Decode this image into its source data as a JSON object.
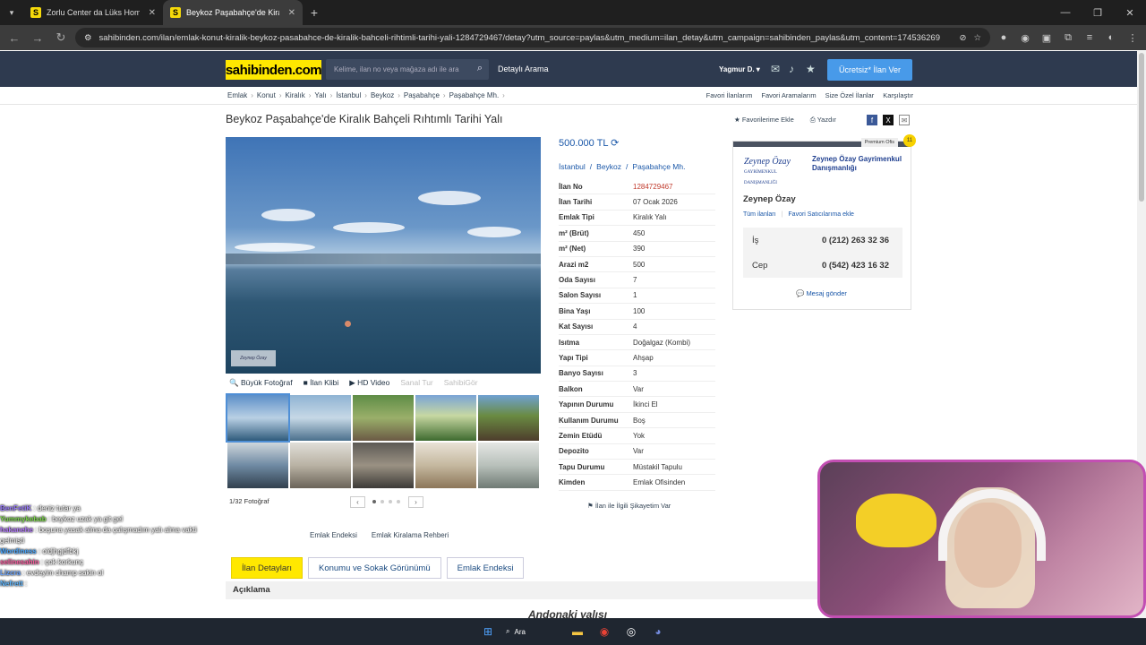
{
  "browser": {
    "tabs": [
      {
        "title": "Zorlu Center da Lüks Home Ofis",
        "active": false
      },
      {
        "title": "Beykoz Paşabahçe'de Kiralık Bahçeli",
        "active": true
      }
    ],
    "url": "sahibinden.com/ilan/emlak-konut-kiralik-beykoz-pasabahce-de-kiralik-bahceli-rihtimli-tarihi-yali-1284729467/detay?utm_source=paylas&utm_medium=ilan_detay&utm_campaign=sahibinden_paylas&utm_content=174536269"
  },
  "header": {
    "logo": "sahibinden.com",
    "search_placeholder": "Kelime, ilan no veya mağaza adı ile ara",
    "advanced_search": "Detaylı Arama",
    "user": "Yagmur D.",
    "post_button": "Ücretsiz* İlan Ver"
  },
  "breadcrumb": [
    "Emlak",
    "Konut",
    "Kiralık",
    "Yalı",
    "İstanbul",
    "Beykoz",
    "Paşabahçe",
    "Paşabahçe Mh."
  ],
  "quick_links": [
    "Favori İlanlarım",
    "Favori Aramalarım",
    "Size Özel İlanlar",
    "Karşılaştır"
  ],
  "listing": {
    "title": "Beykoz Paşabahçe'de Kiralık Bahçeli Rıhtımlı Tarihi Yalı",
    "add_favorite": "Favorilerime Ekle",
    "print": "Yazdır",
    "price": "500.000 TL",
    "location": [
      "İstanbul",
      "Beykoz",
      "Paşabahçe Mh."
    ],
    "attributes": [
      {
        "k": "İlan No",
        "v": "1284729467"
      },
      {
        "k": "İlan Tarihi",
        "v": "07 Ocak 2026"
      },
      {
        "k": "Emlak Tipi",
        "v": "Kiralık Yalı"
      },
      {
        "k": "m² (Brüt)",
        "v": "450"
      },
      {
        "k": "m² (Net)",
        "v": "390"
      },
      {
        "k": "Arazi m2",
        "v": "500"
      },
      {
        "k": "Oda Sayısı",
        "v": "7"
      },
      {
        "k": "Salon Sayısı",
        "v": "1"
      },
      {
        "k": "Bina Yaşı",
        "v": "100"
      },
      {
        "k": "Kat Sayısı",
        "v": "4"
      },
      {
        "k": "Isıtma",
        "v": "Doğalgaz (Kombi)"
      },
      {
        "k": "Yapı Tipi",
        "v": "Ahşap"
      },
      {
        "k": "Banyo Sayısı",
        "v": "3"
      },
      {
        "k": "Balkon",
        "v": "Var"
      },
      {
        "k": "Yapının Durumu",
        "v": "İkinci El"
      },
      {
        "k": "Kullanım Durumu",
        "v": "Boş"
      },
      {
        "k": "Zemin Etüdü",
        "v": "Yok"
      },
      {
        "k": "Depozito",
        "v": "Var"
      },
      {
        "k": "Tapu Durumu",
        "v": "Müstakil Tapulu"
      },
      {
        "k": "Kimden",
        "v": "Emlak Ofisinden"
      }
    ],
    "complaint": "İlan ile İlgili Şikayetim Var"
  },
  "gallery": {
    "tools": [
      "Büyük Fotoğraf",
      "İlan Klibi",
      "HD Video",
      "Sanal Tur",
      "SahibiGör"
    ],
    "counter": "1/32 Fotoğraf",
    "watermark": "Zeynep Özay"
  },
  "seller": {
    "premium": "Premium Ofis",
    "logo_text": "Zeynep Özay",
    "logo_sub": "GAYRİMENKUL DANIŞMANLIĞI",
    "company": "Zeynep Özay Gayrimenkul Danışmanlığı",
    "person": "Zeynep Özay",
    "links": [
      "Tüm ilanları",
      "Favori Satıcılarıma ekle"
    ],
    "phones": [
      {
        "label": "İş",
        "number": "0 (212) 263 32 36"
      },
      {
        "label": "Cep",
        "number": "0 (542) 423 16 32"
      }
    ],
    "message": "Mesaj gönder"
  },
  "bottom": {
    "links": [
      "Emlak Endeksi",
      "Emlak Kiralama Rehberi"
    ],
    "tabs": [
      "İlan Detayları",
      "Konumu ve Sokak Görünümü",
      "Emlak Endeksi"
    ],
    "section": "Açıklama",
    "description_heading": "Andonaki yalısı"
  },
  "chat": [
    {
      "user": "BenFetiK",
      "msg": ": deniz tutar ya",
      "color": "#9b7cff"
    },
    {
      "user": "Yummykebab",
      "msg": ": beykoz uzak ya git gel",
      "color": "#7cd84b"
    },
    {
      "user": "hakanehe",
      "msg": ": boşuna yasak alma da çalışmadım yalı alma vakti gelmişti",
      "color": "#b57bff"
    },
    {
      "user": "Wordiness",
      "msg": ": oldjhgjdfbkj",
      "color": "#4aa8ff"
    },
    {
      "user": "selinesahin",
      "msg": ": çok korkunç",
      "color": "#ff5da2"
    },
    {
      "user": "Lizcra",
      "msg": ": evdeyim champ sakin ol",
      "color": "#6aa4ff"
    },
    {
      "user": "Nefrett",
      "msg": ":",
      "color": "#5fb7ff"
    }
  ],
  "taskbar": {
    "search": "Ara"
  }
}
